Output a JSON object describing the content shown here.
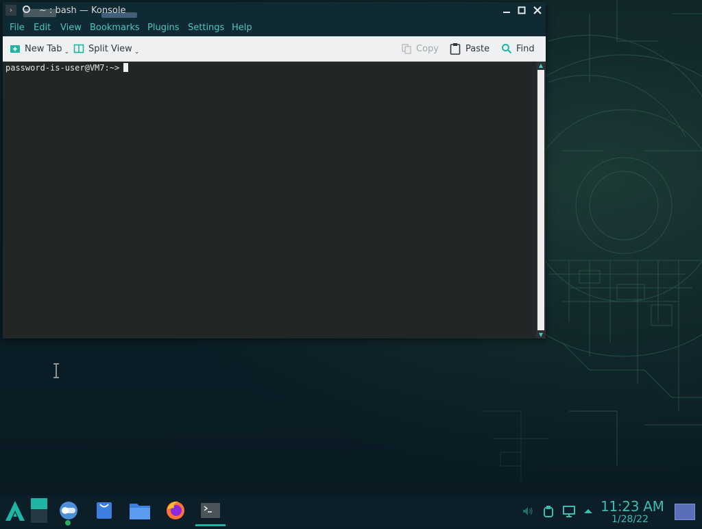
{
  "window": {
    "title": "~ : bash — Konsole"
  },
  "menubar": {
    "items": [
      "File",
      "Edit",
      "View",
      "Bookmarks",
      "Plugins",
      "Settings",
      "Help"
    ]
  },
  "toolbar": {
    "new_tab_label": "New Tab",
    "split_view_label": "Split View",
    "copy_label": "Copy",
    "paste_label": "Paste",
    "find_label": "Find"
  },
  "terminal": {
    "prompt": "password-is-user@VM7:~>"
  },
  "taskbar": {
    "clock_time": "11:23 AM",
    "clock_date": "1/28/22",
    "apps": [
      "app-launcher-icon",
      "show-desktop-icon",
      "discover-icon",
      "store-icon",
      "file-manager-icon",
      "firefox-icon",
      "konsole-icon"
    ],
    "active_app": "konsole-icon"
  },
  "colors": {
    "accent": "#1fb5a4",
    "menu_text": "#4cc6bd",
    "titlebar": "#0f2a33",
    "terminal_bg": "#232627",
    "toolbar_bg": "#eff0f1"
  }
}
